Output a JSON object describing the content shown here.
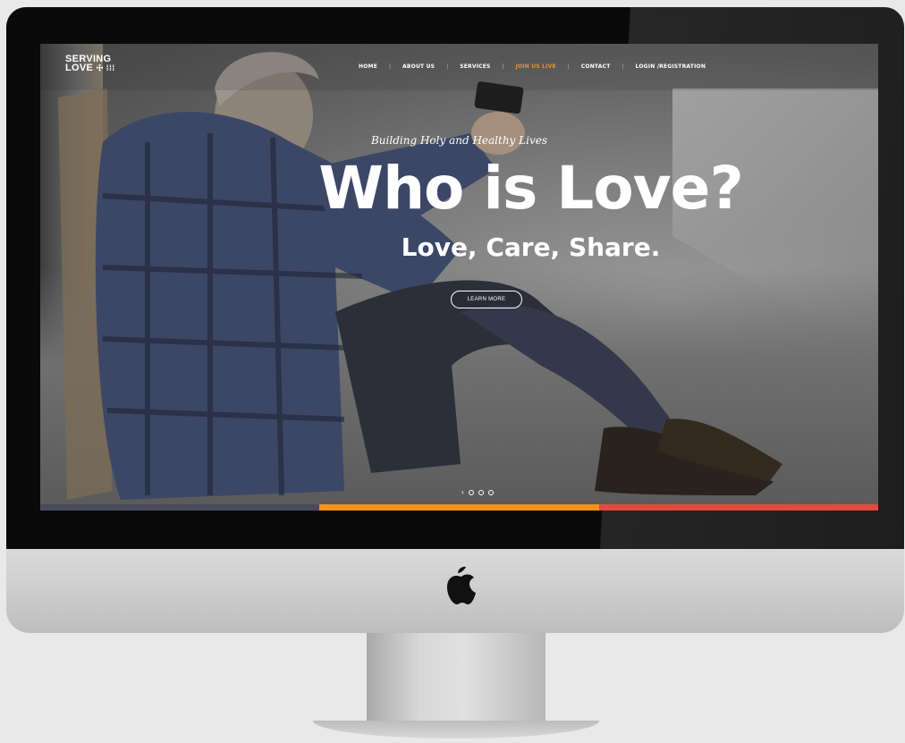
{
  "logo": {
    "line1": "SERVING",
    "line2": "LOVE",
    "mark": "☩ ⁞⁞⁞"
  },
  "nav": {
    "items": [
      {
        "label": "HOME",
        "active": false
      },
      {
        "label": "ABOUT US",
        "active": false
      },
      {
        "label": "SERVICES",
        "active": false
      },
      {
        "label": "JOIN US LIVE",
        "active": true
      },
      {
        "label": "CONTACT",
        "active": false
      },
      {
        "label": "LOGIN /REGISTRATION",
        "active": false
      }
    ]
  },
  "hero": {
    "tagline": "Building Holy and Healthy Lives",
    "headline": "Who is Love?",
    "subhead": "Love, Care, Share.",
    "button_label": "LEARN MORE"
  },
  "slider": {
    "arrow": "›",
    "dot_count": 3,
    "icon": "chevron-right-icon"
  },
  "accent_bars": [
    "#4a4a5e",
    "#f0931e",
    "#e04b3f"
  ],
  "colors": {
    "active_nav": "#f0931e",
    "text": "#ffffff"
  }
}
